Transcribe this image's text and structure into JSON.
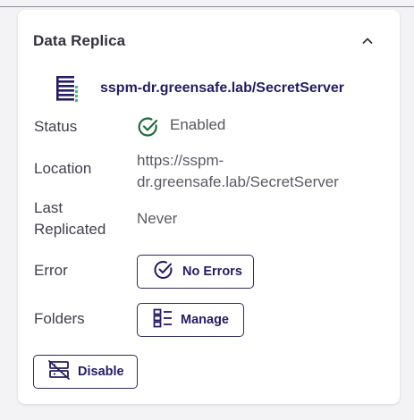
{
  "panel": {
    "title": "Data Replica",
    "collapse_icon": "chevron-up-icon",
    "server_icon": "server-stack-icon",
    "server_name": "sspm-dr.greensafe.lab/SecretServer"
  },
  "fields": {
    "status_label": "Status",
    "status_value": "Enabled",
    "status_icon": "check-circle-icon",
    "location_label": "Location",
    "location_value_line1": "https://sspm-",
    "location_value_line2": "dr.greensafe.lab/SecretServer",
    "last_replicated_label_line1": "Last",
    "last_replicated_label_line2": "Replicated",
    "last_replicated_value": "Never",
    "error_label": "Error",
    "folders_label": "Folders"
  },
  "buttons": {
    "no_errors": "No Errors",
    "no_errors_icon": "check-circle-icon",
    "manage": "Manage",
    "manage_icon": "list-icon",
    "disable": "Disable",
    "disable_icon": "server-off-icon"
  },
  "colors": {
    "accent": "#241c64",
    "success": "#1f6b3a",
    "server_icon_green": "#3ec07a"
  }
}
